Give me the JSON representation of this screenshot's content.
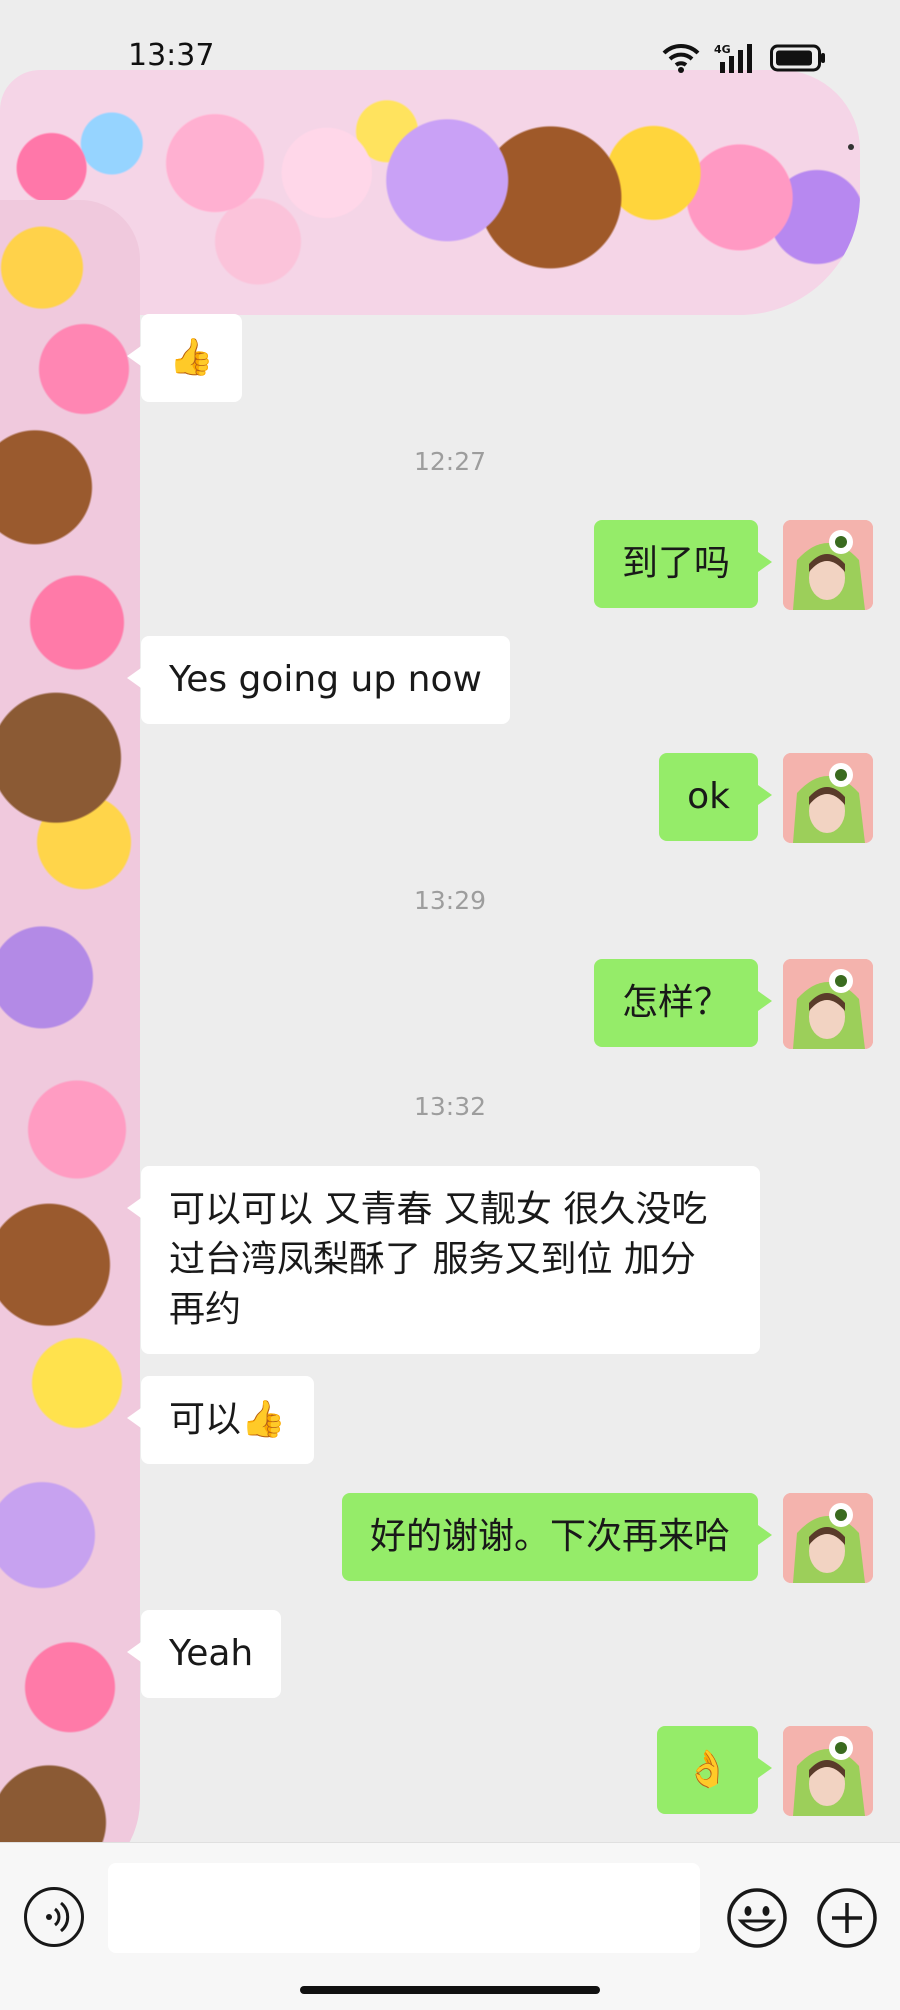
{
  "status_bar": {
    "time": "13:37",
    "network_label": "4G"
  },
  "messages": [
    {
      "kind": "in",
      "text": "👍"
    },
    {
      "kind": "time",
      "text": "12:27"
    },
    {
      "kind": "out",
      "text": "到了吗"
    },
    {
      "kind": "in",
      "text": "Yes going up now"
    },
    {
      "kind": "out",
      "text": "ok"
    },
    {
      "kind": "time",
      "text": "13:29"
    },
    {
      "kind": "out",
      "text": "怎样？"
    },
    {
      "kind": "time",
      "text": "13:32"
    },
    {
      "kind": "in",
      "text": "可以可以 又青春 又靓女 很久没吃\n过台湾凤梨酥了 服务又到位 加分\n再约"
    },
    {
      "kind": "in",
      "text": "可以👍"
    },
    {
      "kind": "out",
      "text": "好的谢谢。下次再来哈"
    },
    {
      "kind": "in",
      "text": "Yeah"
    },
    {
      "kind": "out",
      "text": "👌"
    }
  ],
  "input_bar": {
    "placeholder": "",
    "icons": [
      "voice-icon",
      "emoji-icon",
      "plus-icon"
    ]
  },
  "colors": {
    "background": "#ededed",
    "outgoing_bubble": "#95ec69",
    "incoming_bubble": "#ffffff",
    "timestamp": "#9d9d9d"
  }
}
